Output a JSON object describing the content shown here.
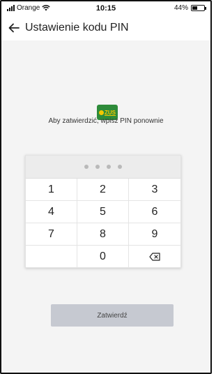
{
  "status_bar": {
    "carrier": "Orange",
    "time": "10:15",
    "battery": "44%",
    "battery_level": 0.44,
    "signal_icon": "signal-bars-icon",
    "wifi_icon": "wifi-icon",
    "battery_icon": "battery-icon"
  },
  "header": {
    "title": "Ustawienie kodu PIN",
    "back_icon": "arrow-left-icon"
  },
  "logo": {
    "text": "ZUS"
  },
  "prompt": "Aby zatwierdzić, wpisz PIN ponownie",
  "pin": {
    "length": 4,
    "entered": 0
  },
  "keypad": {
    "keys": [
      "1",
      "2",
      "3",
      "4",
      "5",
      "6",
      "7",
      "8",
      "9",
      "",
      "0",
      "backspace"
    ],
    "backspace_icon": "backspace-icon"
  },
  "confirm_button": {
    "label": "Zatwierdź",
    "enabled": false
  },
  "colors": {
    "logo_green": "#2e8b3a",
    "logo_yellow": "#f3c800",
    "button_disabled": "#c6c9d1",
    "background": "#f4f4f4"
  }
}
